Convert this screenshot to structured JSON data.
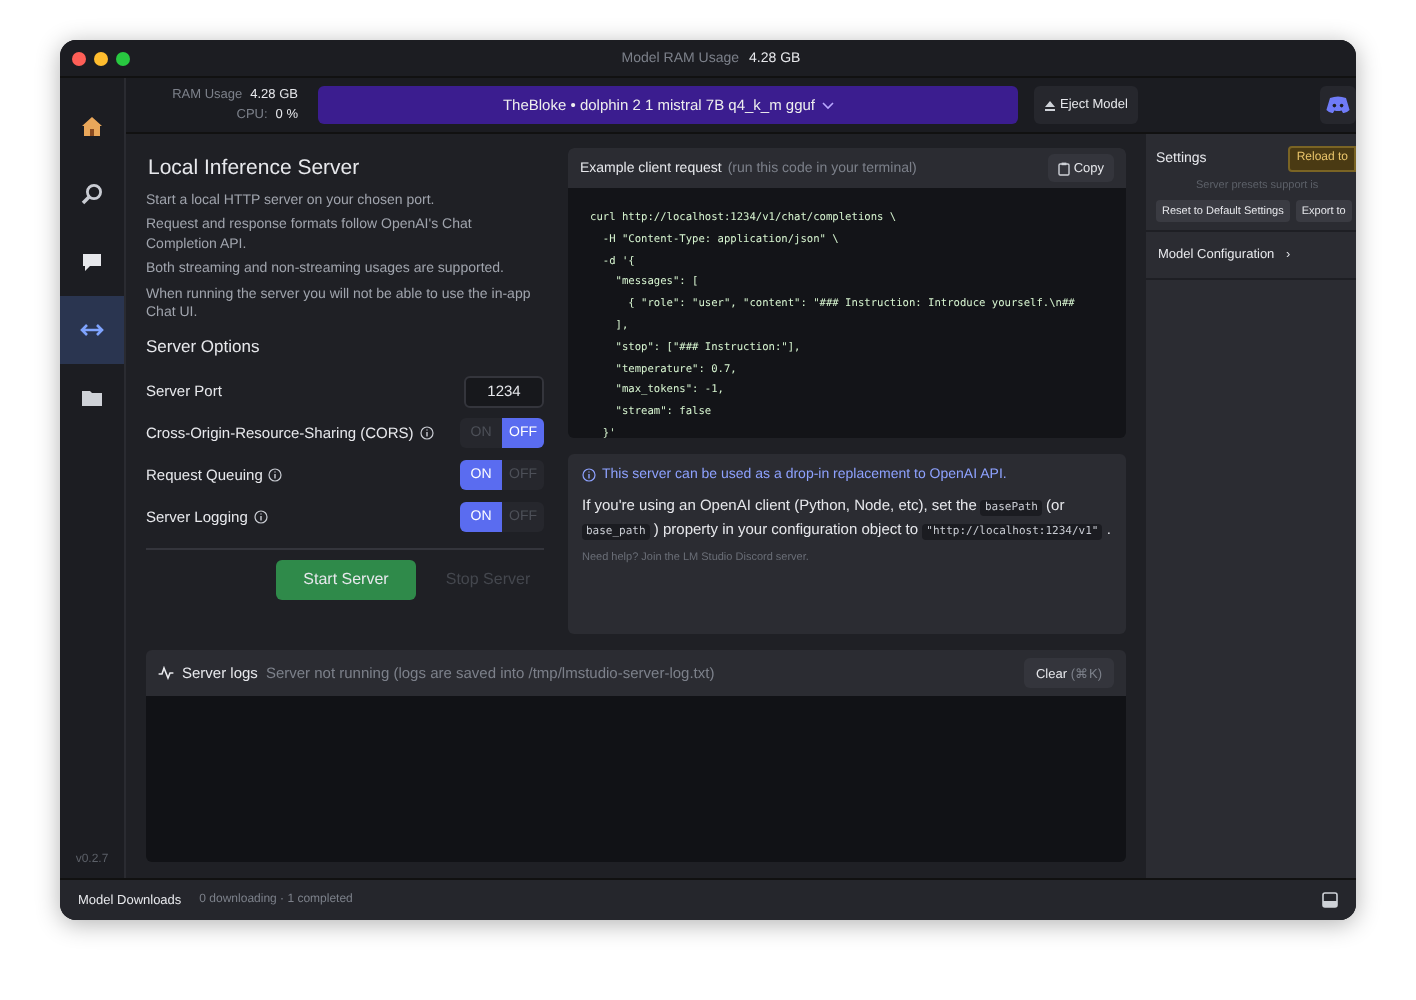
{
  "window": {
    "title": "Model RAM Usage",
    "title_value": "4.28 GB"
  },
  "sidebar": {
    "items": [
      {
        "kind": "home",
        "selected": false
      },
      {
        "kind": "search",
        "selected": false
      },
      {
        "kind": "chat",
        "selected": false
      },
      {
        "kind": "server",
        "selected": true
      },
      {
        "kind": "folder",
        "selected": false
      }
    ],
    "version": "v0.2.7"
  },
  "top_bar": {
    "ram_label": "RAM Usage",
    "ram_value": "4.28 GB",
    "cpu_label": "CPU:",
    "cpu_value": "0 %",
    "model": "TheBloke • dolphin 2 1 mistral 7B q4_k_m gguf",
    "eject": "Eject Model"
  },
  "server": {
    "title": "Local Inference Server",
    "descriptions": [
      "Start a local HTTP server on your chosen port.",
      "Request and response formats follow OpenAI's Chat Completion API.",
      "Both streaming and non-streaming usages are supported.",
      "When running the server you will not be able to use the in-app Chat UI."
    ],
    "options_title": "Server Options",
    "port_label": "Server Port",
    "port_value": "1234",
    "options": [
      {
        "label": "Cross-Origin-Resource-Sharing (CORS)",
        "on": false,
        "on_label": "ON",
        "off_label": "OFF"
      },
      {
        "label": "Request Queuing",
        "on": true,
        "on_label": "ON",
        "off_label": "OFF"
      },
      {
        "label": "Server Logging",
        "on": true,
        "on_label": "ON",
        "off_label": "OFF"
      }
    ],
    "start": "Start Server",
    "stop": "Stop Server",
    "stop_disabled": true
  },
  "example": {
    "title": "Example client request",
    "hint": "(run this code in your terminal)",
    "copy": "Copy",
    "code": [
      "curl http://localhost:1234/v1/chat/completions \\",
      "  -H \"Content-Type: application/json\" \\",
      "  -d '{",
      "    \"messages\": [",
      "      { \"role\": \"user\", \"content\": \"### Instruction: Introduce yourself.\\n##",
      "    ],",
      "    \"stop\": [\"### Instruction:\"],",
      "    \"temperature\": 0.7,",
      "    \"max_tokens\": -1,",
      "    \"stream\": false",
      "  }'"
    ]
  },
  "info": {
    "note": "This server can be used as a drop-in replacement to OpenAI API.",
    "body": [
      {
        "text": "If you're using an OpenAI client (Python, Node, etc), set the ",
        "code": false
      },
      {
        "text": "basePath",
        "code": true
      },
      {
        "text": " (or ",
        "code": false
      },
      {
        "text": "base_path",
        "code": true
      },
      {
        "text": " ) property in your configuration object to ",
        "code": false
      },
      {
        "text": "\"http://localhost:1234/v1\"",
        "code": true
      },
      {
        "text": " .",
        "code": false
      }
    ],
    "help": "Need help? Join the LM Studio Discord server."
  },
  "logs": {
    "title": "Server logs",
    "status": "Server not running (logs are saved into /tmp/lmstudio-server-log.txt)",
    "clear": "Clear",
    "shortcut": "(⌘K)"
  },
  "settings": {
    "title": "Settings",
    "reload": "Reload to",
    "presets_note": "Server presets support is",
    "reset": "Reset to Default Settings",
    "export": "Export to",
    "model_config": "Model Configuration",
    "model_config_caret": "›"
  },
  "status_bar": {
    "title": "Model Downloads",
    "status": "0 downloading · 1 completed"
  }
}
